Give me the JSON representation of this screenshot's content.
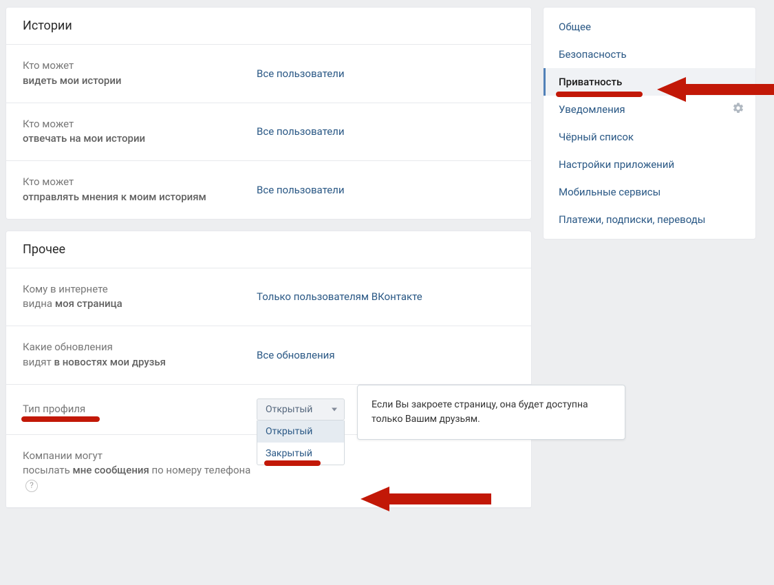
{
  "sections": {
    "stories": {
      "title": "Истории",
      "rows": [
        {
          "prefix": "Кто может",
          "bold": "видеть мои истории",
          "value": "Все пользователи"
        },
        {
          "prefix": "Кто может",
          "bold": "отвечать на мои истории",
          "value": "Все пользователи"
        },
        {
          "prefix": "Кто может",
          "bold": "отправлять мнения к моим историям",
          "value": "Все пользователи"
        }
      ]
    },
    "other": {
      "title": "Прочее",
      "row_page": {
        "prefix": "Кому в интернете",
        "prefix2": "видна ",
        "bold": "моя страница",
        "value": "Только пользователям ВКонтакте"
      },
      "row_updates": {
        "prefix": "Какие обновления",
        "prefix2": "видят ",
        "bold": "в новостях мои друзья",
        "value": "Все обновления"
      },
      "row_profile": {
        "label": "Тип профиля",
        "selected": "Открытый",
        "options": [
          "Открытый",
          "Закрытый"
        ]
      },
      "row_companies": {
        "prefix": "Компании могут",
        "prefix2": "посылать ",
        "bold": "мне сообщения",
        "suffix": " по номеру телефона "
      },
      "tooltip": "Если Вы закроете страницу, она будет доступна только Вашим друзьям."
    }
  },
  "sidebar": {
    "items": [
      {
        "label": "Общее",
        "active": false
      },
      {
        "label": "Безопасность",
        "active": false
      },
      {
        "label": "Приватность",
        "active": true
      },
      {
        "label": "Уведомления",
        "active": false,
        "gear": true
      },
      {
        "label": "Чёрный список",
        "active": false
      },
      {
        "label": "Настройки приложений",
        "active": false
      },
      {
        "label": "Мобильные сервисы",
        "active": false
      },
      {
        "label": "Платежи, подписки, переводы",
        "active": false
      }
    ]
  }
}
